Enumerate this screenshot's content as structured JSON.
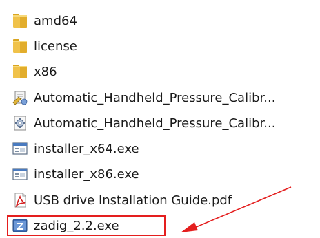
{
  "files": [
    {
      "name": "amd64",
      "icon": "folder-icon"
    },
    {
      "name": "license",
      "icon": "folder-icon"
    },
    {
      "name": "x86",
      "icon": "folder-icon"
    },
    {
      "name": "Automatic_Handheld_Pressure_Calibr...",
      "icon": "setup-config-icon"
    },
    {
      "name": "Automatic_Handheld_Pressure_Calibr...",
      "icon": "settings-file-icon"
    },
    {
      "name": "installer_x64.exe",
      "icon": "executable-icon"
    },
    {
      "name": "installer_x86.exe",
      "icon": "executable-icon"
    },
    {
      "name": "USB drive Installation Guide.pdf",
      "icon": "pdf-icon"
    },
    {
      "name": "zadig_2.2.exe",
      "icon": "zadig-app-icon"
    }
  ],
  "annotation": {
    "highlight_color": "#e41e1e",
    "highlighted_file": "zadig_2.2.exe",
    "arrow_icon": "red-arrow-icon"
  }
}
